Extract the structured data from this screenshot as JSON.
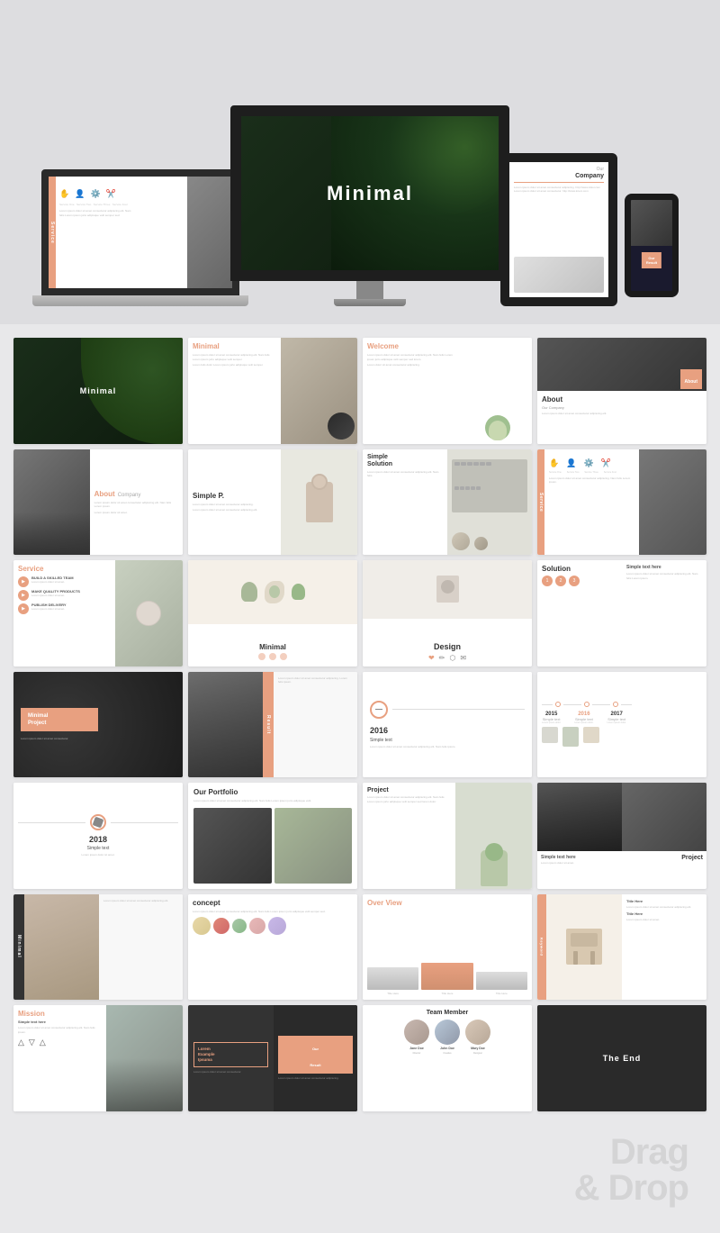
{
  "hero": {
    "monitor_title": "Minimal",
    "laptop_service": "Service",
    "tablet_our_company": "Our",
    "tablet_company": "Company",
    "phone_our": "Our",
    "phone_result": "Result"
  },
  "slides": [
    {
      "id": 1,
      "type": "dark-leaf",
      "title": "Minimal"
    },
    {
      "id": 2,
      "type": "white-minimal",
      "title": "Minimal",
      "subtitle": ""
    },
    {
      "id": 3,
      "type": "welcome",
      "title": "Welcome"
    },
    {
      "id": 4,
      "type": "about-dark",
      "title": "About",
      "subtitle": "Our Company"
    },
    {
      "id": 5,
      "type": "about-company",
      "title": "About",
      "subtitle": "Company"
    },
    {
      "id": 6,
      "type": "simple-p",
      "title": "Simple P."
    },
    {
      "id": 7,
      "type": "simple-solution",
      "title": "Simple",
      "subtitle": "Solution"
    },
    {
      "id": 8,
      "type": "service-icons",
      "title": "Service"
    },
    {
      "id": 9,
      "type": "service-list",
      "title": "Service"
    },
    {
      "id": 10,
      "type": "minimal-design",
      "title": "Minimal"
    },
    {
      "id": 11,
      "type": "design",
      "title": "Design"
    },
    {
      "id": 12,
      "type": "solution",
      "title": "Solution"
    },
    {
      "id": 13,
      "type": "minimal-project",
      "title": "Minimal\nProject"
    },
    {
      "id": 14,
      "type": "result-vertical",
      "title": "Result"
    },
    {
      "id": 15,
      "type": "timeline-2016",
      "year": "2016"
    },
    {
      "id": 16,
      "type": "timeline-multi",
      "years": [
        "2015",
        "2016",
        "2017"
      ]
    },
    {
      "id": 17,
      "type": "timeline-2018",
      "year": "2018"
    },
    {
      "id": 18,
      "type": "portfolio",
      "title": "Our Portfolio"
    },
    {
      "id": 19,
      "type": "project-plant",
      "title": "Project"
    },
    {
      "id": 20,
      "type": "project-buildings",
      "title": "Project"
    },
    {
      "id": 21,
      "type": "minimal-vertical",
      "title": "Minimal"
    },
    {
      "id": 22,
      "type": "concept",
      "title": "concept"
    },
    {
      "id": 23,
      "type": "overview",
      "title": "Over View"
    },
    {
      "id": 24,
      "type": "keyword",
      "title": "Keyword"
    },
    {
      "id": 25,
      "type": "mission",
      "title": "Mission"
    },
    {
      "id": 26,
      "type": "lorem-result",
      "title": "Lorem\nExample\nIpsuma"
    },
    {
      "id": 27,
      "type": "team",
      "title": "Team Member"
    },
    {
      "id": 28,
      "type": "the-end",
      "title": "The End"
    },
    {
      "id": 29,
      "type": "drag-drop",
      "title": "Drag\n& Drop"
    }
  ],
  "drag_drop": {
    "label": "Drag\n& Drop"
  }
}
